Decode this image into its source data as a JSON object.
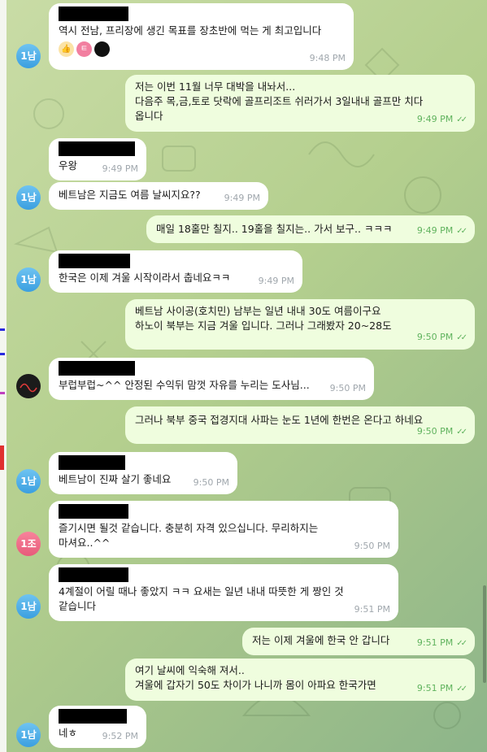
{
  "messages": [
    {
      "avatar": "1남",
      "avatar_color": "blue",
      "text": "역시 전남, 프리장에 생긴 목표를 장초반에 먹는 게 최고입니다",
      "time": "9:48 PM",
      "reactions": [
        "👍",
        "ㅌ",
        "●"
      ]
    },
    {
      "text": "저는 이번 11월 너무 대박을 내놔서...\n다음주 목,금,토로 닷락에 골프리조트 쉬러가서  3일내내 골프만 치다\n옵니다",
      "time": "9:49 PM"
    },
    {
      "text": "우왕",
      "time": "9:49 PM"
    },
    {
      "avatar": "1남",
      "text": "베트남은 지금도 여름 날씨지요??",
      "time": "9:49 PM"
    },
    {
      "text": "매일 18홀만 칠지.. 19홀을 칠지는.. 가서 보구.. ㅋㅋㅋ",
      "time": "9:49 PM"
    },
    {
      "avatar": "1남",
      "text": "한국은 이제 겨울 시작이라서 춥네요ㅋㅋ",
      "time": "9:49 PM"
    },
    {
      "text": "베트남  사이공(호치민) 남부는 일년 내내 30도 여름이구요\n하노이 북부는 지금 겨울 입니다.  그러나 그래봤자  20~28도",
      "time": "9:50 PM"
    },
    {
      "text": "부럽부럽~^^ 안정된 수익뒤 맘껏 자유를 누리는 도사님...",
      "time": "9:50 PM"
    },
    {
      "text": "그러나 북부 중국 접경지대 사파는  눈도 1년에 한번은 온다고 하네요",
      "time": "9:50 PM"
    },
    {
      "avatar": "1남",
      "text": "베트남이 진짜 살기 좋네요",
      "time": "9:50 PM"
    },
    {
      "avatar": "1조",
      "text": "즐기시면 될것 같습니다. 충분히 자격 있으십니다. 무리하지는\n마셔요..^^",
      "time": "9:50 PM"
    },
    {
      "avatar": "1남",
      "text": "4계절이 어릴 때나 좋았지 ㅋㅋ 요새는 일년 내내 따뜻한 게 짱인 것\n같습니다",
      "time": "9:51 PM"
    },
    {
      "text": "저는 이제 겨울에 한국 안 갑니다",
      "time": "9:51 PM"
    },
    {
      "text": "여기 날씨에 익숙해 져서..\n겨울에  갑자기 50도 차이가 나니까 몸이 아파요 한국가면",
      "time": "9:51 PM"
    },
    {
      "avatar": "1남",
      "text": "네ㅎ",
      "time": "9:52 PM"
    }
  ]
}
